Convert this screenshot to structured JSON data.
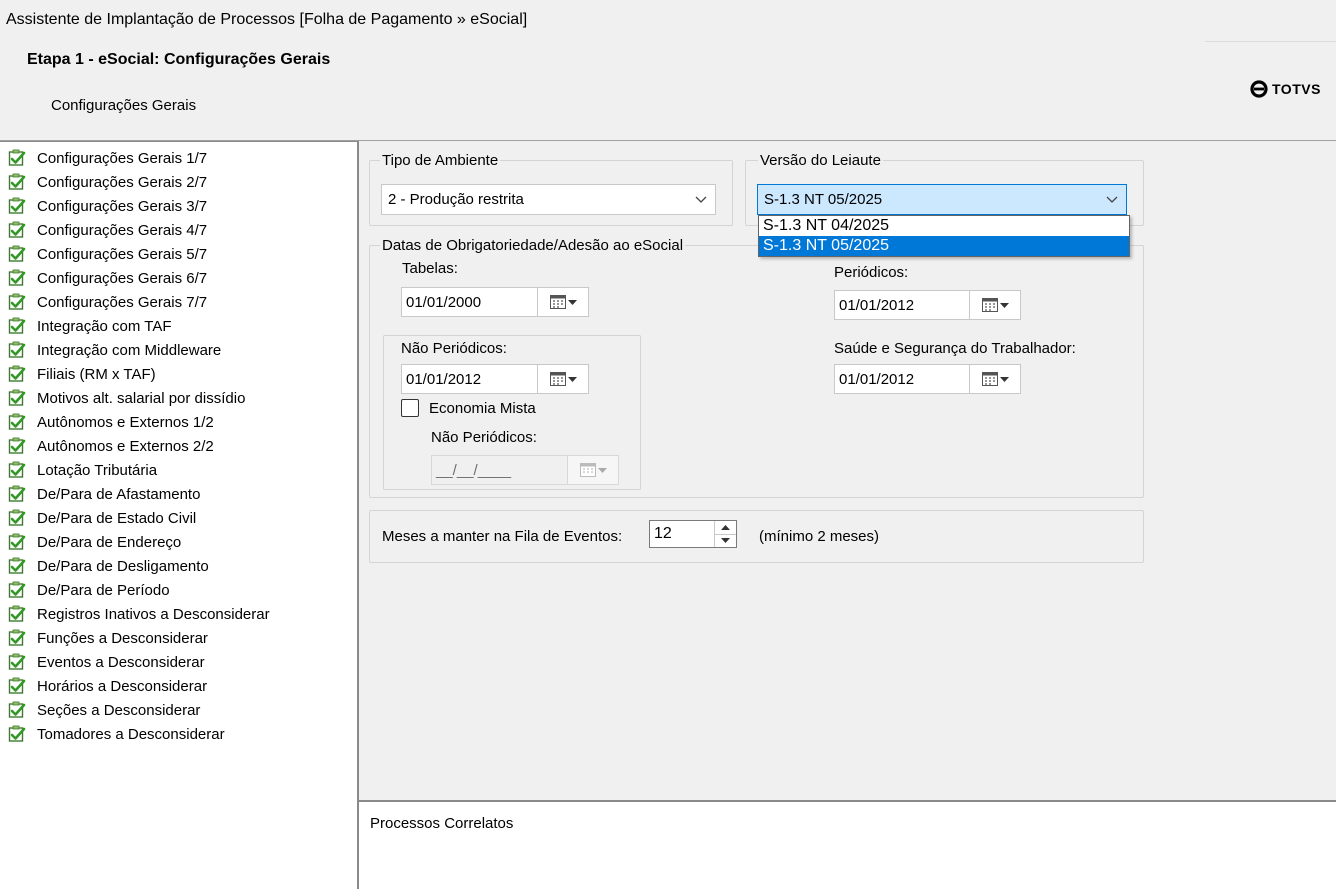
{
  "window": {
    "title": "Assistente de Implantação de Processos [Folha de Pagamento » eSocial]"
  },
  "header": {
    "step_title": "Etapa 1 - eSocial: Configurações Gerais",
    "step_subtitle": "Configurações Gerais",
    "logo_text": "TOTVS"
  },
  "steps": [
    {
      "label": "Configurações Gerais 1/7",
      "icon": "check-icon"
    },
    {
      "label": "Configurações Gerais 2/7",
      "icon": "check-icon"
    },
    {
      "label": "Configurações Gerais 3/7",
      "icon": "check-icon"
    },
    {
      "label": "Configurações Gerais 4/7",
      "icon": "check-icon"
    },
    {
      "label": "Configurações Gerais 5/7",
      "icon": "check-icon"
    },
    {
      "label": "Configurações Gerais 6/7",
      "icon": "check-icon"
    },
    {
      "label": "Configurações Gerais 7/7",
      "icon": "check-icon"
    },
    {
      "label": "Integração com TAF",
      "icon": "check-icon"
    },
    {
      "label": "Integração com Middleware",
      "icon": "check-icon"
    },
    {
      "label": "Filiais (RM x TAF)",
      "icon": "check-icon"
    },
    {
      "label": "Motivos alt. salarial por dissídio",
      "icon": "check-icon"
    },
    {
      "label": "Autônomos e Externos 1/2",
      "icon": "check-icon"
    },
    {
      "label": "Autônomos e Externos 2/2",
      "icon": "check-icon"
    },
    {
      "label": "Lotação Tributária",
      "icon": "check-icon"
    },
    {
      "label": "De/Para de Afastamento",
      "icon": "check-icon"
    },
    {
      "label": "De/Para de Estado Civil",
      "icon": "check-icon"
    },
    {
      "label": "De/Para de Endereço",
      "icon": "check-icon"
    },
    {
      "label": "De/Para de Desligamento",
      "icon": "check-icon"
    },
    {
      "label": "De/Para de Período",
      "icon": "check-icon"
    },
    {
      "label": "Registros Inativos a Desconsiderar",
      "icon": "check-icon"
    },
    {
      "label": "Funções a Desconsiderar",
      "icon": "check-icon"
    },
    {
      "label": "Eventos a Desconsiderar",
      "icon": "check-icon"
    },
    {
      "label": "Horários a Desconsiderar",
      "icon": "check-icon"
    },
    {
      "label": "Seções a Desconsiderar",
      "icon": "check-icon"
    },
    {
      "label": "Tomadores a Desconsiderar",
      "icon": "check-icon"
    }
  ],
  "ambiente": {
    "group_title": "Tipo de Ambiente",
    "selected": "2 - Produção restrita"
  },
  "leiaute": {
    "group_title": "Versão do Leiaute",
    "selected": "S-1.3 NT 05/2025",
    "options": [
      "S-1.3 NT 04/2025",
      "S-1.3 NT 05/2025"
    ],
    "highlighted": "S-1.3 NT 05/2025"
  },
  "datas": {
    "group_title": "Datas de Obrigatoriedade/Adesão ao eSocial",
    "tabelas_label": "Tabelas:",
    "tabelas_value": "01/01/2000",
    "periodicos_label": "Periódicos:",
    "periodicos_value": "01/01/2012",
    "nao_periodicos_label": "Não Periódicos:",
    "nao_periodicos_value": "01/01/2012",
    "economia_mista_label": "Economia Mista",
    "economia_mista_checked": false,
    "em_nao_periodicos_label": "Não Periódicos:",
    "em_nao_periodicos_value": "__/__/____",
    "sst_label": "Saúde e Segurança do Trabalhador:",
    "sst_value": "01/01/2012"
  },
  "fila": {
    "label": "Meses a manter na Fila de Eventos:",
    "value": "12",
    "hint": "(mínimo 2 meses)"
  },
  "bottom": {
    "label": "Processos Correlatos"
  },
  "colors": {
    "background": "#f0f0f0",
    "selection": "#0078d7",
    "check_green": "#3a9a2b"
  }
}
